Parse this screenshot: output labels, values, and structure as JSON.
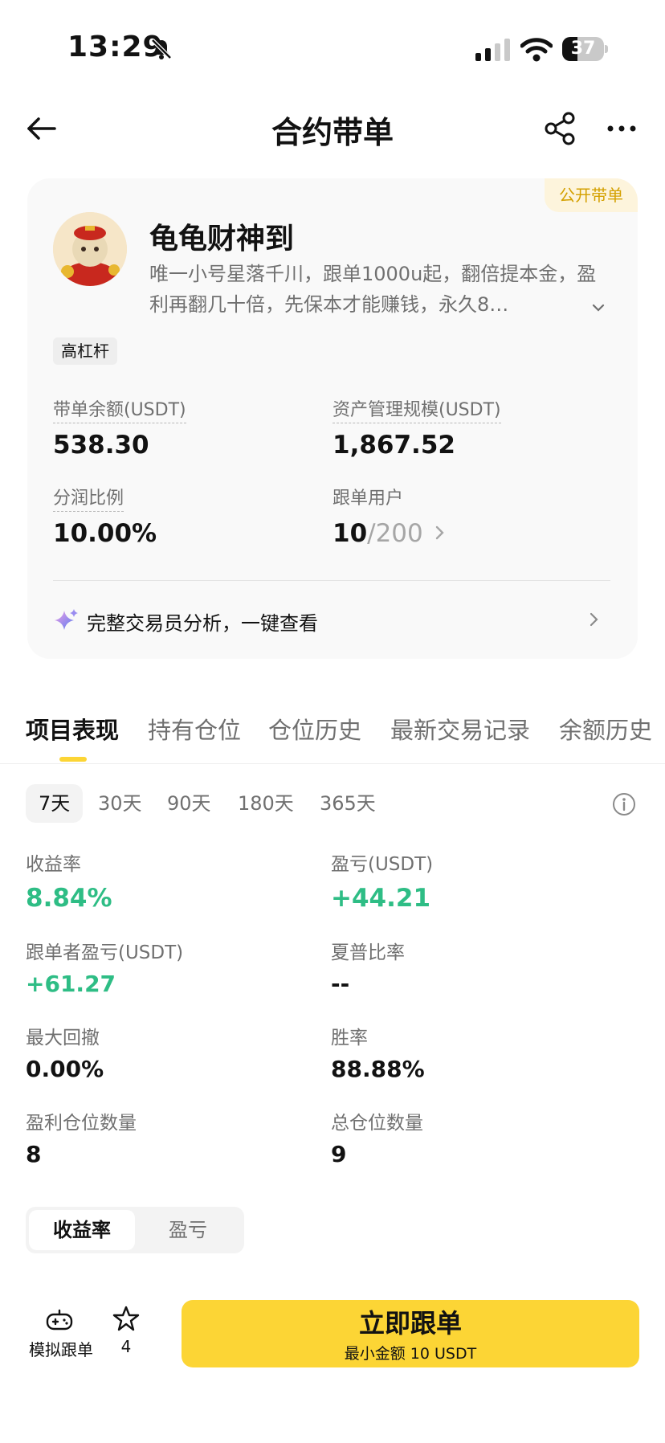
{
  "status_bar": {
    "time": "13:29",
    "battery": "37",
    "battery_level": 0.37
  },
  "nav": {
    "title": "合约带单"
  },
  "trader": {
    "badge": "公开带单",
    "name": "龟龟财神到",
    "bio": "唯一小号星落千川，跟单1000u起，翻倍提本金，盈利再翻几十倍，先保本才能赚钱，永久8…",
    "tag": "高杠杆",
    "stats": {
      "balance_label": "带单余额(USDT)",
      "balance_value": "538.30",
      "aum_label": "资产管理规模(USDT)",
      "aum_value": "1,867.52",
      "share_label": "分润比例",
      "share_value": "10.00%",
      "followers_label": "跟单用户",
      "followers_count": "10",
      "followers_max": "/200"
    },
    "analysis": "完整交易员分析，一键查看"
  },
  "tabs": [
    "项目表现",
    "持有仓位",
    "仓位历史",
    "最新交易记录",
    "余额历史"
  ],
  "periods": [
    "7天",
    "30天",
    "90天",
    "180天",
    "365天"
  ],
  "metrics": {
    "roi_label": "收益率",
    "roi_value": "8.84%",
    "pnl_label": "盈亏(USDT)",
    "pnl_value": "+44.21",
    "copier_pnl_label": "跟单者盈亏(USDT)",
    "copier_pnl_value": "+61.27",
    "sharpe_label": "夏普比率",
    "sharpe_value": "--",
    "mdd_label": "最大回撤",
    "mdd_value": "0.00%",
    "winrate_label": "胜率",
    "winrate_value": "88.88%",
    "win_positions_label": "盈利仓位数量",
    "win_positions_value": "8",
    "total_positions_label": "总仓位数量",
    "total_positions_value": "9"
  },
  "chart_toggle": [
    "收益率",
    "盈亏"
  ],
  "bottom": {
    "sim_label": "模拟跟单",
    "star_count": "4",
    "follow_label": "立即跟单",
    "follow_sub": "最小金额 10 USDT"
  },
  "colors": {
    "accent": "#fcd535",
    "positive": "#2ebd85",
    "badge_text": "#d4a000"
  }
}
